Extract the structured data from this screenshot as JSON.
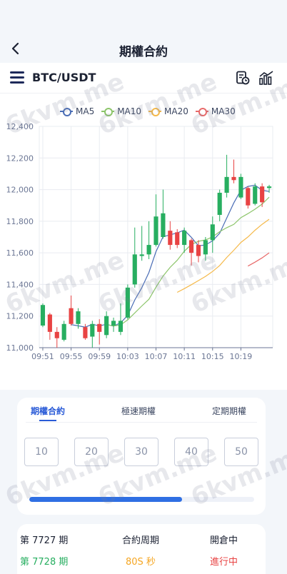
{
  "header": {
    "title": "期權合約"
  },
  "symbol_bar": {
    "symbol": "BTC/USDT"
  },
  "chart_data": {
    "type": "candlestick",
    "legend": [
      "MA5",
      "MA10",
      "MA20",
      "MA30"
    ],
    "colors": {
      "up": "#27ae60",
      "down": "#e84343",
      "MA5": "#4a6db5",
      "MA10": "#8cc56a",
      "MA20": "#f5b94a",
      "MA30": "#e86a6a",
      "grid": "#e9ecf1",
      "axis": "#6b7694"
    },
    "ylim": [
      11000,
      12400
    ],
    "yticks": [
      11000,
      11200,
      11400,
      11600,
      11800,
      12000,
      12200,
      12400
    ],
    "ytick_labels": [
      "11,000",
      "11,200",
      "11,400",
      "11,600",
      "11,800",
      "12,000",
      "12,200",
      "12,400"
    ],
    "xtick_labels": [
      "09:51",
      "09:55",
      "09:59",
      "10:03",
      "10:07",
      "10:11",
      "10:15",
      "10:19"
    ],
    "xtick_index": [
      0,
      4,
      8,
      12,
      16,
      20,
      24,
      28
    ],
    "candles": [
      {
        "o": 11140,
        "c": 11270,
        "h": 11280,
        "l": 11130
      },
      {
        "o": 11210,
        "c": 11100,
        "h": 11220,
        "l": 11050
      },
      {
        "o": 11100,
        "c": 11060,
        "h": 11130,
        "l": 11000
      },
      {
        "o": 11050,
        "c": 11150,
        "h": 11170,
        "l": 11040
      },
      {
        "o": 11250,
        "c": 11150,
        "h": 11330,
        "l": 11140
      },
      {
        "o": 11150,
        "c": 11230,
        "h": 11250,
        "l": 11120
      },
      {
        "o": 11130,
        "c": 11060,
        "h": 11150,
        "l": 11050
      },
      {
        "o": 11070,
        "c": 11150,
        "h": 11170,
        "l": 11000
      },
      {
        "o": 11150,
        "c": 11100,
        "h": 11180,
        "l": 11020
      },
      {
        "o": 11080,
        "c": 11200,
        "h": 11230,
        "l": 11060
      },
      {
        "o": 11140,
        "c": 11170,
        "h": 11190,
        "l": 11100
      },
      {
        "o": 11100,
        "c": 11170,
        "h": 11280,
        "l": 11080
      },
      {
        "o": 11190,
        "c": 11380,
        "h": 11400,
        "l": 11180
      },
      {
        "o": 11400,
        "c": 11590,
        "h": 11760,
        "l": 11380
      },
      {
        "o": 11580,
        "c": 11590,
        "h": 11770,
        "l": 11550
      },
      {
        "o": 11590,
        "c": 11650,
        "h": 11800,
        "l": 11560
      },
      {
        "o": 11650,
        "c": 11830,
        "h": 11970,
        "l": 11640
      },
      {
        "o": 11700,
        "c": 11850,
        "h": 12000,
        "l": 11690
      },
      {
        "o": 11740,
        "c": 11650,
        "h": 11800,
        "l": 11620
      },
      {
        "o": 11730,
        "c": 11650,
        "h": 11750,
        "l": 11630
      },
      {
        "o": 11650,
        "c": 11740,
        "h": 11760,
        "l": 11600
      },
      {
        "o": 11680,
        "c": 11600,
        "h": 11690,
        "l": 11520
      },
      {
        "o": 11650,
        "c": 11580,
        "h": 11680,
        "l": 11540
      },
      {
        "o": 11590,
        "c": 11680,
        "h": 11700,
        "l": 11550
      },
      {
        "o": 11680,
        "c": 11780,
        "h": 11830,
        "l": 11600
      },
      {
        "o": 11840,
        "c": 11980,
        "h": 12000,
        "l": 11800
      },
      {
        "o": 11980,
        "c": 12080,
        "h": 12220,
        "l": 11950
      },
      {
        "o": 12080,
        "c": 12060,
        "h": 12190,
        "l": 12040
      },
      {
        "o": 11950,
        "c": 12080,
        "h": 12100,
        "l": 11940
      },
      {
        "o": 12010,
        "c": 11900,
        "h": 12020,
        "l": 11880
      },
      {
        "o": 11910,
        "c": 12020,
        "h": 12040,
        "l": 11900
      },
      {
        "o": 12020,
        "c": 11920,
        "h": 12040,
        "l": 11890
      },
      {
        "o": 12010,
        "c": 12020,
        "h": 12030,
        "l": 11980
      }
    ]
  },
  "tabs": [
    {
      "label": "期權合約"
    },
    {
      "label": "極速期權"
    },
    {
      "label": "定期期權"
    }
  ],
  "duration_options": [
    {
      "label": "10"
    },
    {
      "label": "20"
    },
    {
      "label": "30"
    },
    {
      "label": "40"
    },
    {
      "label": "50"
    }
  ],
  "progress": {
    "value": 0.68,
    "color": "#2f6fe3"
  },
  "period_table": {
    "row1": {
      "period": "第 7727 期",
      "cycle": "合約周期",
      "status": "開倉中"
    },
    "row2": {
      "period": "第 7728 期",
      "cycle": "80S 秒",
      "status": "進行中"
    },
    "colors": {
      "green": "#27ae60",
      "orange": "#f5a623",
      "red": "#e84343"
    }
  },
  "watermark": "6kvm.me"
}
